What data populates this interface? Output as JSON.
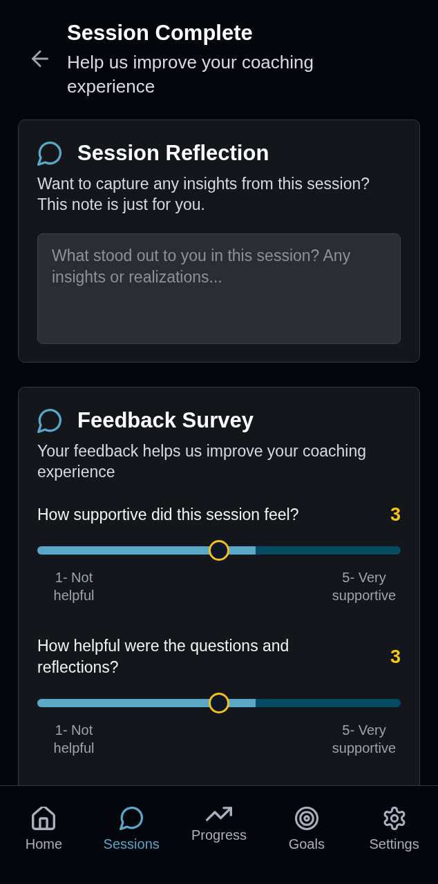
{
  "header": {
    "title": "Session Complete",
    "subtitle": "Help us improve your coaching experience"
  },
  "reflection": {
    "title": "Session Reflection",
    "description": "Want to capture any insights from this session? This note is just for you.",
    "note": {
      "placeholder": "What stood out to you in this session? Any insights or realizations..."
    }
  },
  "survey": {
    "title": "Feedback Survey",
    "description": "Your feedback helps us improve your coaching experience",
    "questions": [
      {
        "question": "How supportive did this session feel?",
        "value": "3",
        "level": 0.5,
        "min_label": "1- Not helpful",
        "max_label": "5- Very supportive"
      },
      {
        "question": "How helpful were the questions and reflections?",
        "value": "3",
        "level": 0.5,
        "min_label": "1- Not helpful",
        "max_label": "5- Very supportive"
      }
    ]
  },
  "nav": {
    "items": [
      {
        "label": "Home",
        "selected": false
      },
      {
        "label": "Sessions",
        "selected": true
      },
      {
        "label": "Progress",
        "selected": false
      },
      {
        "label": "Goals",
        "selected": false
      },
      {
        "label": "Settings",
        "selected": false
      }
    ]
  }
}
